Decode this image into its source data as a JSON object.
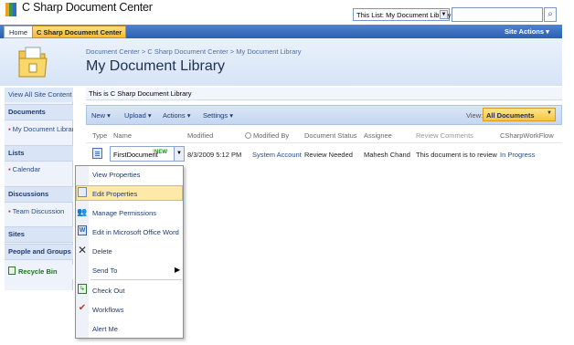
{
  "site": {
    "title": "C Sharp Document Center"
  },
  "search": {
    "scope": "This List: My Document Library",
    "placeholder": ""
  },
  "nav": {
    "tabs": [
      "Home",
      "C Sharp Document Center"
    ],
    "site_actions": "Site Actions ▾"
  },
  "header": {
    "breadcrumb": "Document Center > C Sharp Document Center > My Document Library",
    "title": "My Document Library"
  },
  "leftnav": {
    "view_all": "View All Site Content",
    "documents": "Documents",
    "my_doc_lib": "My Document Library",
    "lists": "Lists",
    "calendar": "Calendar",
    "discussions": "Discussions",
    "team_discussion": "Team Discussion",
    "sites": "Sites",
    "people_groups": "People and Groups",
    "recycle_bin": "Recycle Bin"
  },
  "library": {
    "description": "This is C Sharp Document Library"
  },
  "toolbar": {
    "new": "New",
    "upload": "Upload",
    "actions": "Actions",
    "settings": "Settings",
    "view_label": "View:",
    "view_value": "All Documents"
  },
  "table": {
    "columns": [
      "Type",
      "Name",
      "Modified",
      "Modified By",
      "Document Status",
      "Assignee",
      "Review Comments",
      "CSharpWorkFlow"
    ],
    "rows": [
      {
        "name": "FirstDocument",
        "new_badge": "NEW",
        "modified": "8/3/2009 5:12 PM",
        "modified_by": "System Account",
        "status": "Review Needed",
        "assignee": "Mahesh Chand",
        "comments": "This document is to review",
        "workflow": "In Progress"
      }
    ]
  },
  "context_menu": {
    "items": [
      "View Properties",
      "Edit Properties",
      "Manage Permissions",
      "Edit in Microsoft Office Word",
      "Delete",
      "Send To",
      "Check Out",
      "Workflows",
      "Alert Me"
    ]
  },
  "colors": {
    "nav_blue": "#2b5fb0",
    "highlight": "#fde9a8",
    "link": "#2a4b85"
  }
}
